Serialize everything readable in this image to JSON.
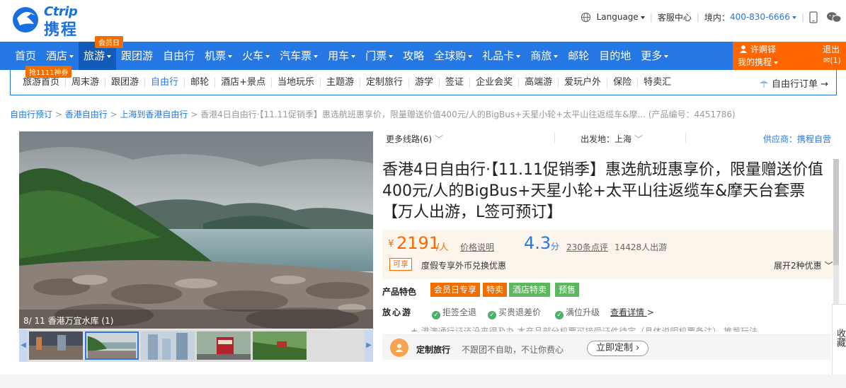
{
  "brand": {
    "logo_en": "Ctrip",
    "logo_cn": "携程"
  },
  "topbar": {
    "language_label": "Language",
    "service_label": "客服中心",
    "domestic_label": "境内：",
    "phone": "400-830-6666"
  },
  "nav": {
    "items": [
      "首页",
      "酒店",
      "旅游",
      "跟团游",
      "自由行",
      "机票",
      "火车",
      "汽车票",
      "用车",
      "门票",
      "攻略",
      "全球购",
      "礼品卡",
      "商旅",
      "邮轮",
      "目的地",
      "更多"
    ],
    "has_dropdown": [
      false,
      true,
      true,
      false,
      false,
      true,
      true,
      true,
      true,
      true,
      false,
      true,
      true,
      true,
      false,
      false,
      true
    ],
    "active_index": 2,
    "badge_member": "会员日",
    "user_name": "许婀铎",
    "my_ctrip": "我的携程",
    "logout": "退出",
    "mail_count": "(1)"
  },
  "subnav": {
    "badge": "抢1111神券",
    "items": [
      "旅游首页",
      "周末游",
      "跟团游",
      "自由行",
      "邮轮",
      "酒店+景点",
      "当地玩乐",
      "主题游",
      "定制旅行",
      "游学",
      "签证",
      "企业会奖",
      "高端游",
      "爱玩户外",
      "保险",
      "特卖汇"
    ],
    "active_index": 3,
    "orders_label": "自由行订单 →"
  },
  "breadcrumb": {
    "links": [
      "自由行预订",
      "香港自由行",
      "上海到香港自由行"
    ],
    "current": "香港4日自由行·【11.11促销季】惠选航班惠享价，限量赠送价值400元/人的BigBus+天星小轮+太平山往返缆车&摩... (产品编号：4451786)"
  },
  "gallery": {
    "caption": "8/ 11 香港万宜水库 (1)",
    "prev_icon": "chevron-left-icon",
    "next_icon": "chevron-right-icon",
    "selected_thumb": 1
  },
  "product": {
    "more_routes": "更多线路(6)",
    "departure": "出发地：上海",
    "supplier": "供应商：携程自营",
    "title": "香港4日自由行·【11.11促销季】惠选航班惠享价，限量赠送价值400元/人的BigBus+天星小轮+太平山往返缆车&摩天台套票【万人出游，L签可预订】",
    "currency": "¥",
    "price": "2191",
    "per_person": "/人",
    "price_help": "价格说明",
    "score": "4.3",
    "score_unit": "分",
    "review_count": "230条点评",
    "travelers": "14428人出游",
    "kexiang_badge": "可享",
    "kexiang_text": "度假专享外币兑换优惠",
    "expand_offers": "展开2种优惠",
    "features_label": "产品特色",
    "tags": [
      {
        "label": "会员日专享",
        "color": "#f26d00"
      },
      {
        "label": "特卖",
        "color": "#f26d00"
      },
      {
        "label": "酒店特卖",
        "color": "#5cb85c"
      },
      {
        "label": "预售",
        "color": "#5cb85c"
      }
    ],
    "assurance_label": "放心游",
    "assurances": [
      "拒签全退",
      "买贵退差价",
      "满位升级"
    ],
    "see_detail": "查看详情",
    "custom_title": "定制旅行",
    "custom_sub": "不跟团不自助，不让你费心",
    "custom_button": "立即定制",
    "obscured_line": "★ 港澳通行证还没来得及办   本产品部分机票可接受证件待定（具体说明机票备注）      推荐玩法",
    "side_fav": "收藏"
  }
}
